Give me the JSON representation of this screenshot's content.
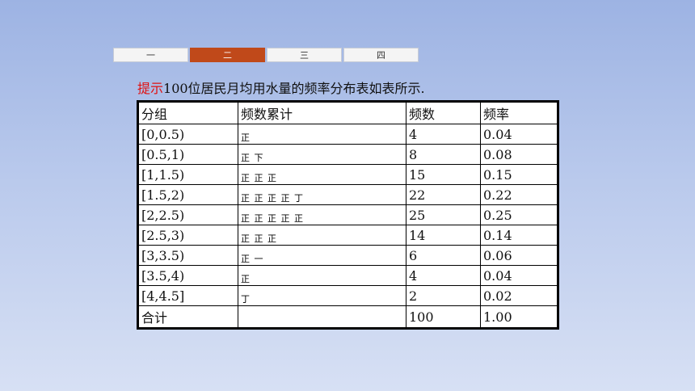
{
  "tabs": [
    "一",
    "二",
    "三",
    "四"
  ],
  "hint": {
    "label": "提示",
    "text": "100位居民月均用水量的频率分布表如表所示."
  },
  "table": {
    "headers": [
      "分组",
      "频数累计",
      "频数",
      "频率"
    ],
    "rows": [
      [
        "[0,0.5)",
        "正",
        "4",
        "0.04"
      ],
      [
        "[0.5,1)",
        "正 下",
        "8",
        "0.08"
      ],
      [
        "[1,1.5)",
        "正 正 正",
        "15",
        "0.15"
      ],
      [
        "[1.5,2)",
        "正 正 正 正 丁",
        "22",
        "0.22"
      ],
      [
        "[2,2.5)",
        "正 正 正 正 正",
        "25",
        "0.25"
      ],
      [
        "[2.5,3)",
        "正 正 正",
        "14",
        "0.14"
      ],
      [
        "[3,3.5)",
        "正 一",
        "6",
        "0.06"
      ],
      [
        "[3.5,4)",
        "正",
        "4",
        "0.04"
      ],
      [
        "[4,4.5]",
        "丁",
        "2",
        "0.02"
      ]
    ],
    "total": [
      "合计",
      "",
      "100",
      "1.00"
    ]
  }
}
